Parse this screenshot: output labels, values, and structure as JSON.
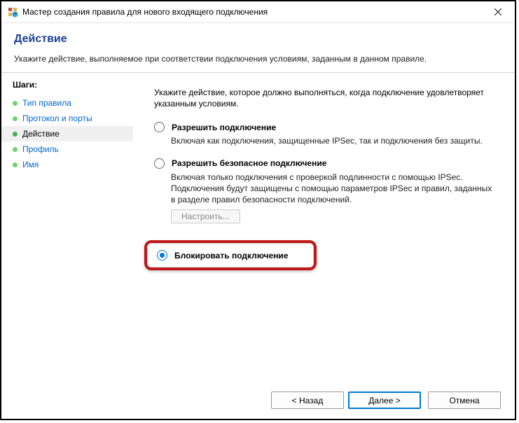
{
  "window": {
    "title": "Мастер создания правила для нового входящего подключения"
  },
  "header": {
    "heading": "Действие",
    "subheading": "Укажите действие, выполняемое при соответствии подключения условиям, заданным в данном правиле."
  },
  "steps": {
    "title": "Шаги:",
    "items": [
      {
        "label": "Тип правила"
      },
      {
        "label": "Протокол и порты"
      },
      {
        "label": "Действие"
      },
      {
        "label": "Профиль"
      },
      {
        "label": "Имя"
      }
    ],
    "current_index": 2
  },
  "main": {
    "intro": "Укажите действие, которое должно выполняться, когда подключение удовлетворяет указанным условиям.",
    "options": [
      {
        "label": "Разрешить подключение",
        "description": "Включая как подключения, защищенные IPSec, так и подключения без защиты."
      },
      {
        "label": "Разрешить безопасное подключение",
        "description": "Включая только подключения с проверкой подлинности с помощью IPSec. Подключения будут защищены с помощью параметров IPSec и правил, заданных в разделе правил безопасности подключений."
      },
      {
        "label": "Блокировать подключение"
      }
    ],
    "configure_label": "Настроить...",
    "selected_index": 2
  },
  "footer": {
    "back": "< Назад",
    "next": "Далее >",
    "cancel": "Отмена"
  }
}
